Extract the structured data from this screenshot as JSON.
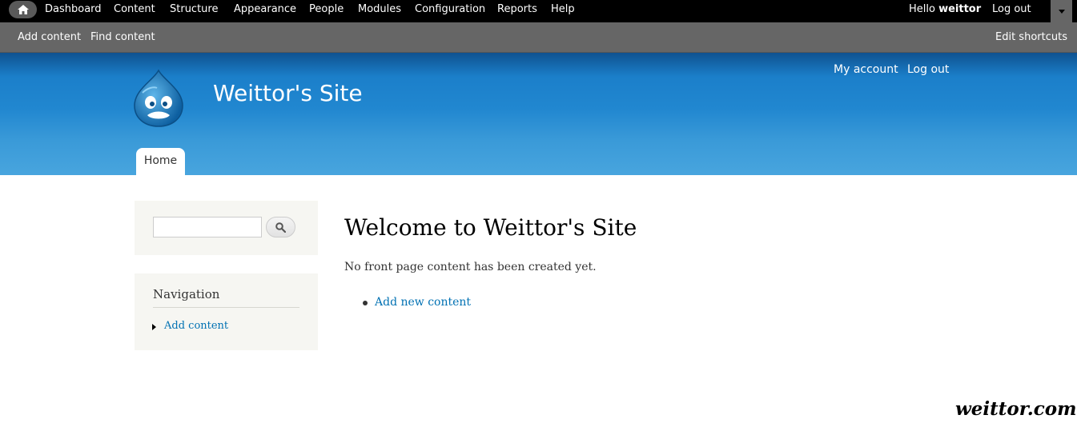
{
  "toolbar": {
    "menu": [
      "Dashboard",
      "Content",
      "Structure",
      "Appearance",
      "People",
      "Modules",
      "Configuration",
      "Reports",
      "Help"
    ],
    "hello_prefix": "Hello",
    "username": "weittor",
    "logout": "Log out",
    "icons": {
      "home": "home-icon",
      "toggle": "chevron-down-icon"
    }
  },
  "shortcuts": {
    "items": [
      "Add content",
      "Find content"
    ],
    "edit": "Edit shortcuts"
  },
  "header": {
    "site_name": "Weittor's Site",
    "secondary_menu": [
      "My account",
      "Log out"
    ],
    "tabs": [
      "Home"
    ],
    "colors": {
      "gradient_top": "#0f5290",
      "gradient_bottom": "#48a5de"
    }
  },
  "sidebar": {
    "search": {
      "value": "",
      "icon": "search-icon"
    },
    "navigation": {
      "title": "Navigation",
      "items": [
        "Add content"
      ]
    }
  },
  "main": {
    "title": "Welcome to Weittor's Site",
    "message": "No front page content has been created yet.",
    "links": [
      "Add new content"
    ],
    "link_color": "#0071b3"
  },
  "watermark": "weittor.com"
}
